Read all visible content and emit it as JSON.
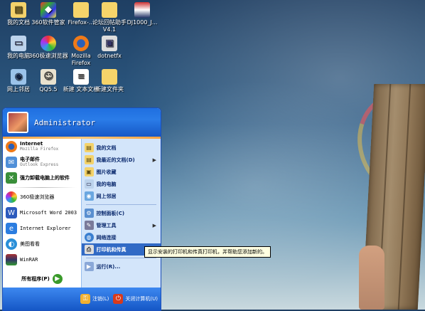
{
  "desktop": {
    "icons": [
      {
        "label": "我的文档",
        "icon": "my-documents-icon"
      },
      {
        "label": "360软件管家",
        "icon": "software-manager-icon"
      },
      {
        "label": "Firefox-...",
        "icon": "folder-icon"
      },
      {
        "label": "论坛回帖助手V4.1",
        "icon": "folder-icon"
      },
      {
        "label": "DJ1000_J...",
        "icon": "app-icon"
      },
      {
        "label": "我的电脑",
        "icon": "my-computer-icon"
      },
      {
        "label": "360极速浏览器",
        "icon": "browser-360-icon"
      },
      {
        "label": "Mozilla Firefox",
        "icon": "firefox-icon"
      },
      {
        "label": "dotnetfx",
        "icon": "installer-icon"
      },
      {
        "label": "网上邻居",
        "icon": "network-icon"
      },
      {
        "label": "QQ5.5",
        "icon": "qq-icon"
      },
      {
        "label": "新建 文本文档",
        "icon": "text-file-icon"
      },
      {
        "label": "新建文件夹",
        "icon": "folder-icon"
      }
    ]
  },
  "start_menu": {
    "user": "Administrator",
    "pinned": [
      {
        "title": "Internet",
        "subtitle": "Mozilla Firefox",
        "icon": "firefox-icon"
      },
      {
        "title": "电子邮件",
        "subtitle": "Outlook Express",
        "icon": "email-icon"
      }
    ],
    "recent": [
      {
        "label": "强力卸载电脑上的软件",
        "icon": "uninstall-icon"
      },
      {
        "label": "360极速浏览器",
        "icon": "browser-360-icon"
      },
      {
        "label": "Microsoft Word 2003",
        "icon": "word-icon"
      },
      {
        "label": "Internet Explorer",
        "icon": "ie-icon"
      },
      {
        "label": "美图看看",
        "icon": "image-viewer-icon"
      },
      {
        "label": "WinRAR",
        "icon": "winrar-icon"
      }
    ],
    "all_programs": "所有程序(P)",
    "right": [
      {
        "label": "我的文档",
        "icon": "my-documents-icon",
        "chev": ""
      },
      {
        "label": "我最近的文档(D)",
        "icon": "recent-docs-icon",
        "chev": "▶"
      },
      {
        "label": "图片收藏",
        "icon": "pictures-icon",
        "chev": ""
      },
      {
        "label": "我的电脑",
        "icon": "my-computer-icon",
        "chev": ""
      },
      {
        "label": "网上邻居",
        "icon": "network-icon",
        "chev": ""
      },
      {
        "label": "控制面板(C)",
        "icon": "control-panel-icon",
        "chev": ""
      },
      {
        "label": "管理工具",
        "icon": "admin-tools-icon",
        "chev": "▶"
      },
      {
        "label": "网络连接",
        "icon": "network-connections-icon",
        "chev": ""
      },
      {
        "label": "打印机和传真",
        "icon": "printer-icon",
        "chev": ""
      },
      {
        "label": "运行(R)...",
        "icon": "run-icon",
        "chev": ""
      }
    ],
    "logoff": "注销(L)",
    "shutdown": "关闭计算机(U)"
  },
  "tooltip": "显示安装的打印机和传真打印机，并帮助您添加新的。"
}
